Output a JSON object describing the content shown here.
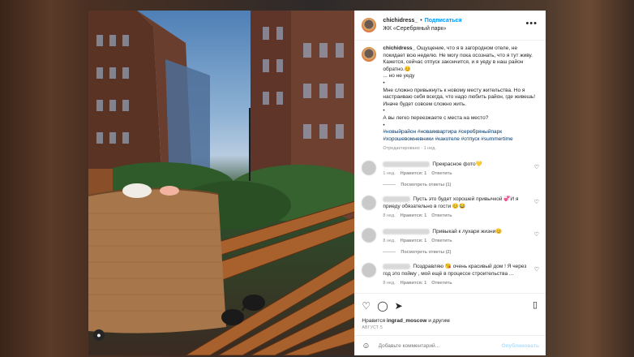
{
  "post": {
    "username": "chichidress_",
    "follow_label": "Подписаться",
    "location": "ЖК «Серебряный парк»",
    "more_icon": "more-dots-icon",
    "caption_lines": [
      "Ощущение, что я в загородном отеле, не покидает всю неделю. Не могу пока осознать, что я тут живу. Кажется, сейчас отпуск закончится, и я уеду в наш район обратно.😊",
      "... но не уеду",
      "•",
      "Мне сложно привыкнуть к новому месту жительства. Но я настраиваю себя всегда, что надо любить район, где живешь! Иначе будет совсем сложно жить.",
      "•",
      "А вы легко переезжаете с места на место?",
      "•"
    ],
    "hashtags": "#новыйрайон #новаяквартира #серебряныйпарк #хорошевомневники #какотеле #отпуск #summertime",
    "caption_meta": "Отредактировано · 1 нед.",
    "comments": [
      {
        "text": "Прекрасное фото💛",
        "time": "1 нед.",
        "likes": "Нравится: 1",
        "reply": "Ответить",
        "replies": "Посмотреть ответы (1)"
      },
      {
        "text": "Пусть это будет хорошей привычкой 💞И я приеду обязательно в гости 😊😂",
        "time": "8 нед.",
        "likes": "Нравится: 1",
        "reply": "Ответить",
        "replies": ""
      },
      {
        "text": "Привыкай к лухари жизни😊",
        "time": "8 нед.",
        "likes": "Нравится: 1",
        "reply": "Ответить",
        "replies": "Посмотреть ответы (2)"
      },
      {
        "text": "Поздравляю 😘 очень красивый дом ! Я через год это пойму , мой ещё в процессе строительства ...",
        "time": "8 нед.",
        "likes": "Нравится: 1",
        "reply": "Ответить",
        "replies": ""
      }
    ],
    "liked_by_prefix": "Нравится ",
    "liked_by_user": "ingrad_moscow",
    "liked_by_suffix": " и другим",
    "date": "АВГУСТ 5",
    "comment_placeholder": "Добавьте комментарий...",
    "publish_label": "Опубликовать"
  },
  "colors": {
    "accent": "#0095f6",
    "publish_disabled": "#b2dffc",
    "hashtag": "#00376b"
  }
}
